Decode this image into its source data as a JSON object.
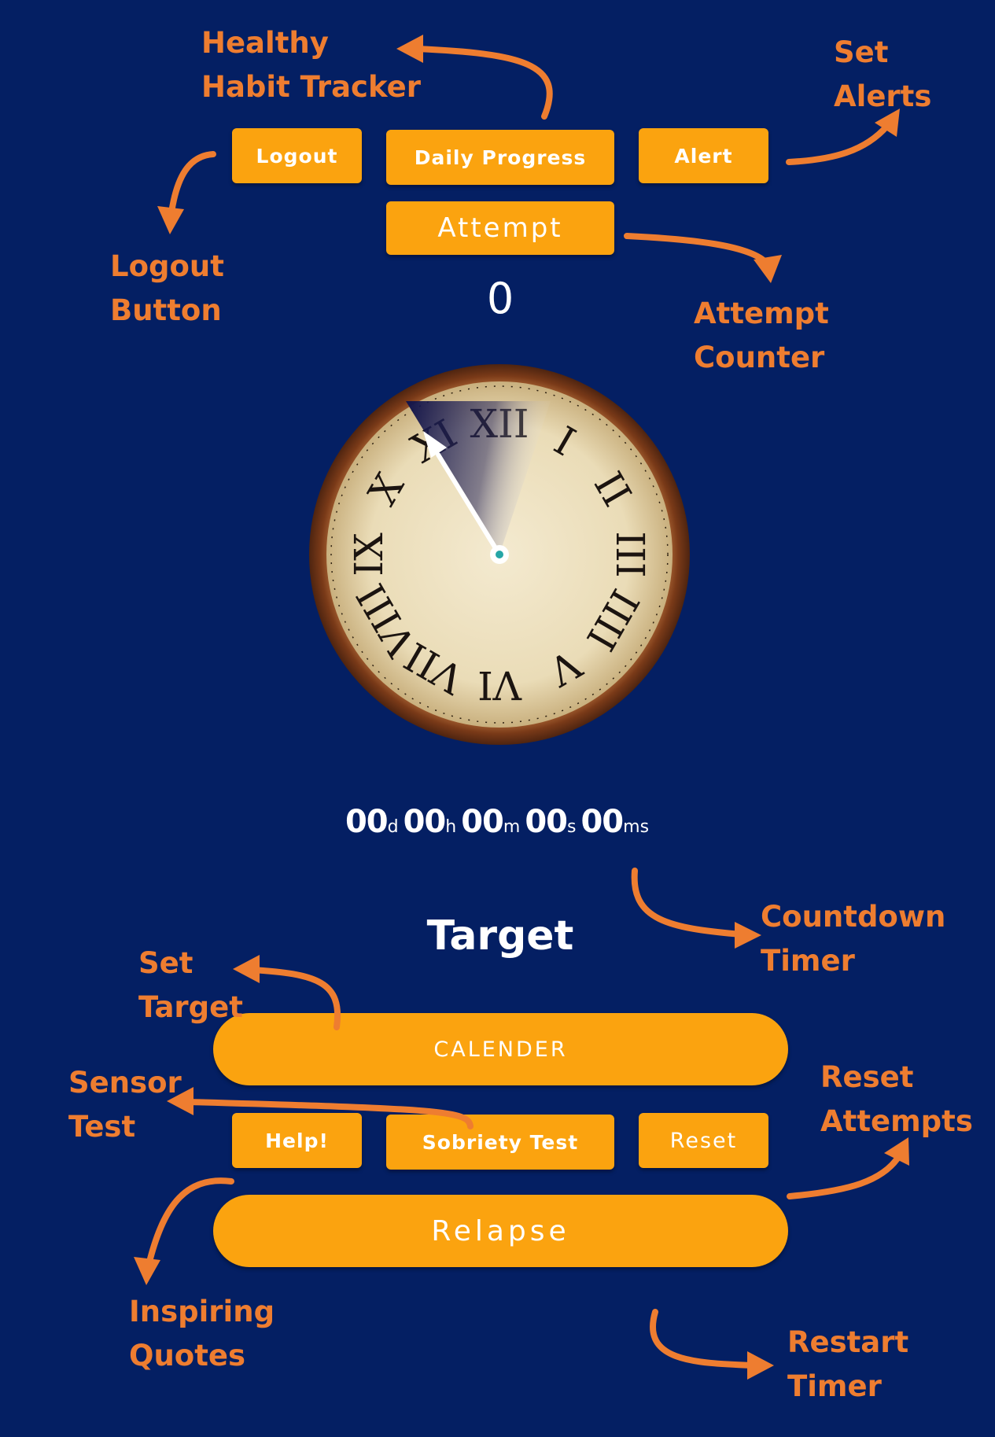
{
  "header": {
    "logout_label": "Logout",
    "daily_progress_label": "Daily Progress",
    "alert_label": "Alert",
    "attempt_label": "Attempt"
  },
  "attempt_counter": "0",
  "clock": {
    "numerals": [
      "XII",
      "I",
      "II",
      "III",
      "IIII",
      "V",
      "VI",
      "VII",
      "VIII",
      "IX",
      "X",
      "XI"
    ]
  },
  "timer": {
    "days": "00",
    "days_unit": "d",
    "hours": "00",
    "hours_unit": "h",
    "minutes": "00",
    "minutes_unit": "m",
    "seconds": "00",
    "seconds_unit": "s",
    "millis": "00",
    "millis_unit": "ms"
  },
  "target": {
    "heading": "Target",
    "calendar_label": "CALENDER"
  },
  "actions": {
    "help_label": "Help!",
    "sobriety_label": "Sobriety Test",
    "reset_label": "Reset",
    "relapse_label": "Relapse"
  },
  "annotations": {
    "healthy_habit": [
      "Healthy",
      "Habit Tracker"
    ],
    "set_alerts": [
      "Set",
      "Alerts"
    ],
    "logout_button": [
      "Logout",
      "Button"
    ],
    "attempt_counter": [
      "Attempt",
      "Counter"
    ],
    "countdown_timer": [
      "Countdown",
      "Timer"
    ],
    "set_target": [
      "Set",
      "Target"
    ],
    "sensor_test": [
      "Sensor",
      "Test"
    ],
    "reset_attempts": [
      "Reset",
      "Attempts"
    ],
    "inspiring_quotes": [
      "Inspiring",
      "Quotes"
    ],
    "restart_timer": [
      "Restart",
      "Timer"
    ]
  },
  "colors": {
    "background": "#041f63",
    "button": "#fba30f",
    "annotation": "#ee7d30",
    "clock_face": "#efe3c2",
    "clock_rim": "#8b4a22"
  }
}
